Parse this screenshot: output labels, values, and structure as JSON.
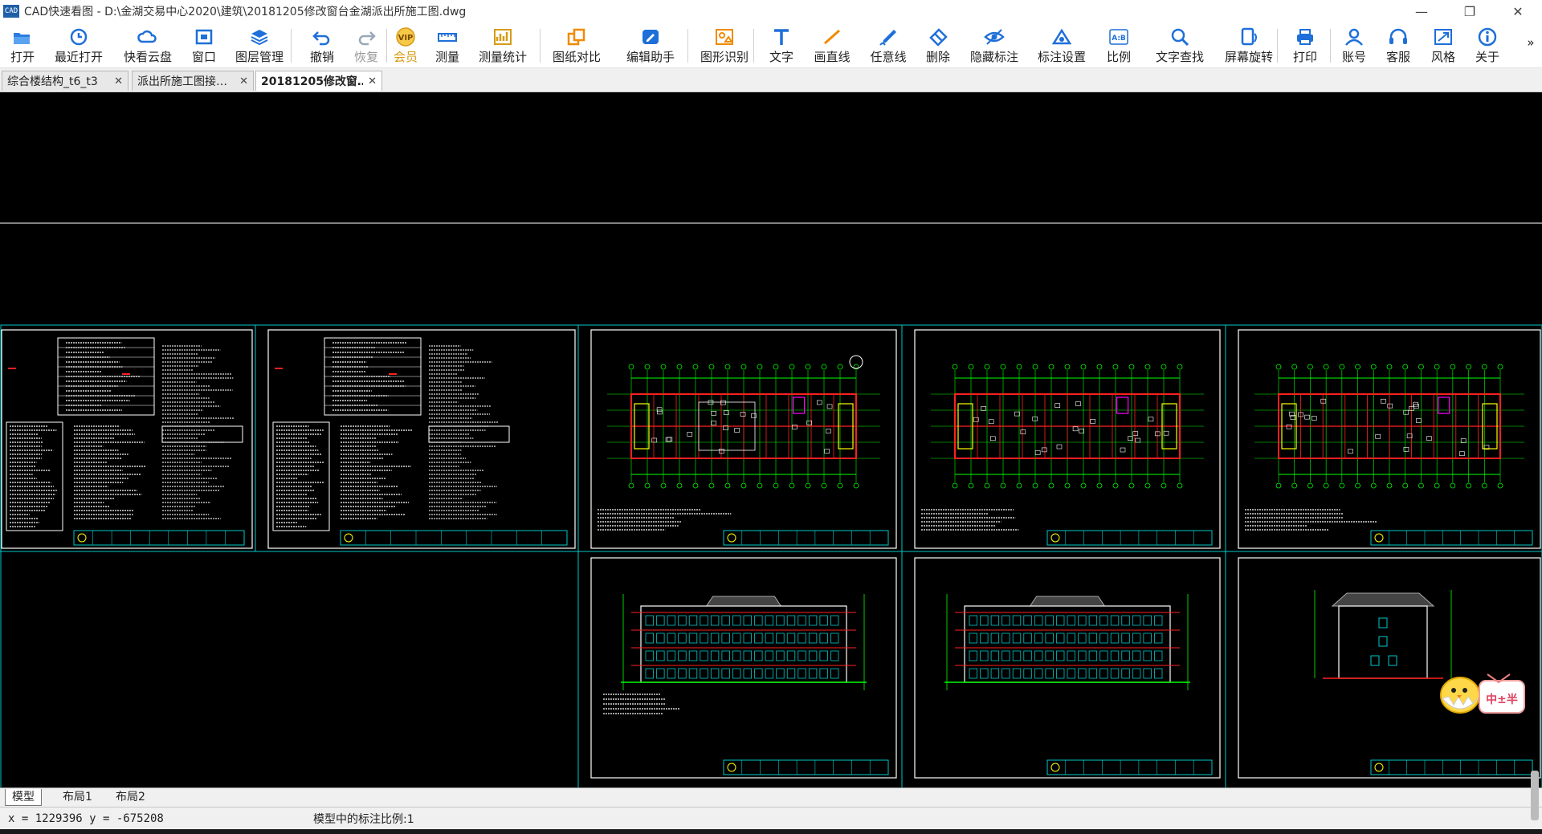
{
  "window": {
    "title": "CAD快速看图 - D:\\金湖交易中心2020\\建筑\\20181205修改窗台金湖派出所施工图.dwg",
    "app_icon_text": "CAD",
    "controls": {
      "minimize": "—",
      "restore": "❐",
      "close": "✕"
    }
  },
  "toolbar": {
    "items": [
      {
        "label": "打开",
        "icon": "folder-open-icon"
      },
      {
        "label": "最近打开",
        "icon": "clock-icon"
      },
      {
        "label": "快看云盘",
        "icon": "cloud-icon"
      },
      {
        "label": "窗口",
        "icon": "window-icon"
      },
      {
        "label": "图层管理",
        "icon": "layers-icon"
      },
      {
        "label": "撤销",
        "icon": "undo-icon"
      },
      {
        "label": "恢复",
        "icon": "redo-icon",
        "disabled": true
      },
      {
        "label": "会员",
        "icon": "vip-icon",
        "badge": "VIP"
      },
      {
        "label": "测量",
        "icon": "ruler-icon"
      },
      {
        "label": "测量统计",
        "icon": "measure-stats-icon"
      },
      {
        "label": "图纸对比",
        "icon": "compare-icon"
      },
      {
        "label": "编辑助手",
        "icon": "edit-assistant-icon"
      },
      {
        "label": "图形识别",
        "icon": "shape-recognize-icon"
      },
      {
        "label": "文字",
        "icon": "text-icon"
      },
      {
        "label": "画直线",
        "icon": "line-icon"
      },
      {
        "label": "任意线",
        "icon": "freehand-icon"
      },
      {
        "label": "删除",
        "icon": "eraser-icon"
      },
      {
        "label": "隐藏标注",
        "icon": "eye-hide-icon"
      },
      {
        "label": "标注设置",
        "icon": "annotation-settings-icon"
      },
      {
        "label": "比例",
        "icon": "scale-icon",
        "badge": "A:B"
      },
      {
        "label": "文字查找",
        "icon": "text-search-icon"
      },
      {
        "label": "屏幕旋转",
        "icon": "rotate-screen-icon"
      },
      {
        "label": "打印",
        "icon": "printer-icon"
      },
      {
        "label": "账号",
        "icon": "user-icon"
      },
      {
        "label": "客服",
        "icon": "headset-icon"
      },
      {
        "label": "风格",
        "icon": "style-icon"
      },
      {
        "label": "关于",
        "icon": "info-icon"
      }
    ],
    "overflow": "»"
  },
  "tabs": [
    {
      "label": "综合楼结构_t6_t3",
      "active": false
    },
    {
      "label": "派出所施工图接…",
      "active": false
    },
    {
      "label": "20181205修改窗…",
      "active": true
    }
  ],
  "tab_close": "✕",
  "layout_tabs": [
    {
      "label": "模型",
      "active": true
    },
    {
      "label": "布局1",
      "active": false
    },
    {
      "label": "布局2",
      "active": false
    }
  ],
  "status": {
    "coords": "x = 1229396  y = -675208",
    "scale": "模型中的标注比例:1"
  },
  "mascot_text": "中±半",
  "drawing": {
    "sheets": [
      "notes",
      "notes",
      "plan",
      "plan",
      "plan",
      "elevation",
      "elevation",
      "side-elevation"
    ]
  },
  "colors": {
    "accent": "#1e6fd9",
    "vip": "#d79b14",
    "cad_cyan": "#00c8c8",
    "cad_green": "#00ff00",
    "cad_red": "#ff2020",
    "cad_yellow": "#ffff00",
    "cad_magenta": "#ff00ff"
  }
}
